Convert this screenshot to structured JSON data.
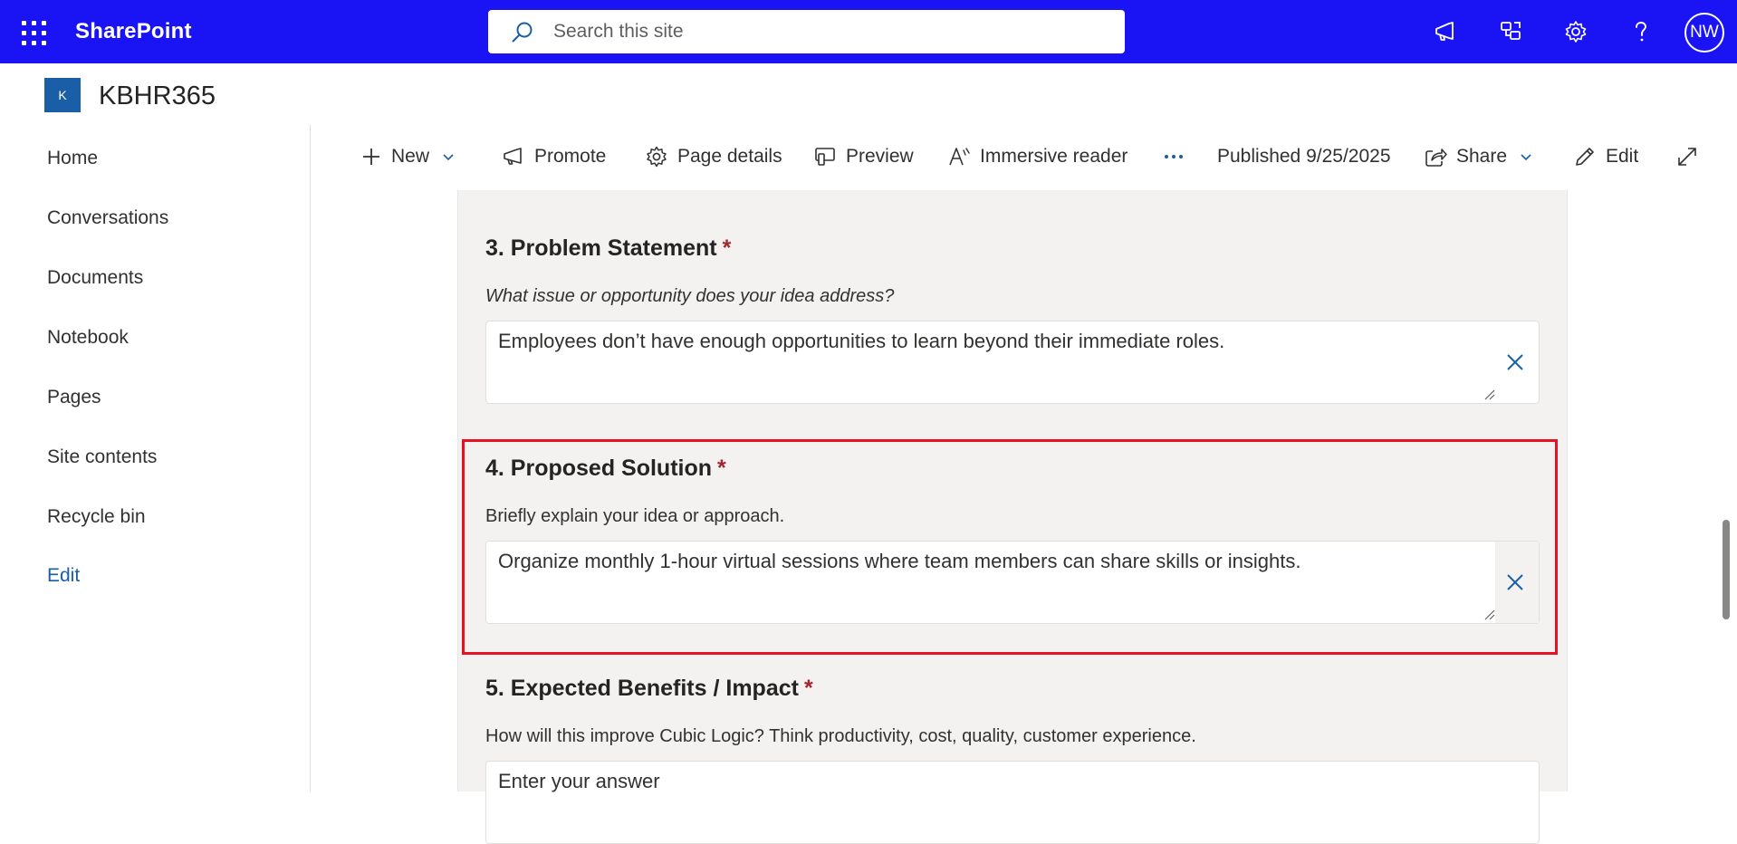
{
  "suitebar": {
    "brand": "SharePoint",
    "search_placeholder": "Search this site",
    "avatar_initials": "NW",
    "bg_color": "#1a14f5",
    "icons": [
      "waffle-icon",
      "megaphone-icon",
      "teams-connect-icon",
      "gear-icon",
      "help-icon"
    ]
  },
  "site": {
    "logo_letter": "K",
    "title": "KBHR365"
  },
  "leftnav": {
    "items": [
      "Home",
      "Conversations",
      "Documents",
      "Notebook",
      "Pages",
      "Site contents",
      "Recycle bin"
    ],
    "edit_label": "Edit"
  },
  "commandbar": {
    "new_label": "New",
    "promote_label": "Promote",
    "page_details_label": "Page details",
    "preview_label": "Preview",
    "immersive_reader_label": "Immersive reader",
    "published_label": "Published 9/25/2025",
    "share_label": "Share",
    "edit_label": "Edit"
  },
  "form": {
    "questions": [
      {
        "title": "3. Problem Statement",
        "required_mark": "*",
        "help": "What issue or opportunity does your idea address?",
        "value": "Employees don’t have enough opportunities to learn beyond their immediate roles."
      },
      {
        "title": "4. Proposed Solution",
        "required_mark": "*",
        "help": "Briefly explain your idea or approach.",
        "value": "Organize monthly 1-hour virtual sessions where team members can share skills or insights."
      },
      {
        "title": "5. Expected Benefits / Impact",
        "required_mark": "*",
        "help": "How will this improve Cubic Logic? Think productivity, cost, quality, customer experience.",
        "placeholder": "Enter your answer"
      }
    ]
  },
  "colors": {
    "accent": "#1a5ea8",
    "required": "#a4262c",
    "highlight": "#e81123"
  }
}
